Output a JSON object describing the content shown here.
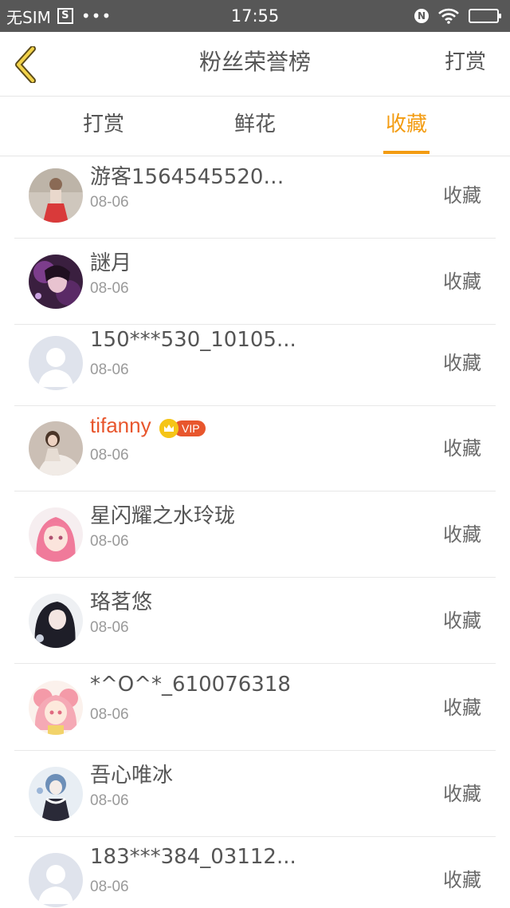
{
  "status_bar": {
    "carrier": "无SIM",
    "s_icon_label": "S",
    "dots": "•••",
    "time": "17:55",
    "n_icon_label": "N"
  },
  "nav": {
    "back_icon": "chevron-left-icon",
    "title": "粉丝荣誉榜",
    "action_label": "打赏"
  },
  "tabs": [
    {
      "label": "打赏",
      "active": false
    },
    {
      "label": "鲜花",
      "active": false
    },
    {
      "label": "收藏",
      "active": true
    }
  ],
  "accent_color": "#f39c12",
  "vip_color": "#e8562d",
  "list": {
    "items": [
      {
        "name": "游客1564545520…",
        "date": "08-06",
        "action": "收藏",
        "avatar": "girl-photo"
      },
      {
        "name": "謎月",
        "date": "08-06",
        "action": "收藏",
        "avatar": "anime-dark"
      },
      {
        "name": "150***530_10105...",
        "date": "08-06",
        "action": "收藏",
        "avatar": "default"
      },
      {
        "name": "tifanny",
        "date": "08-06",
        "action": "收藏",
        "avatar": "woman-photo",
        "vip": true,
        "vip_label": "VIP"
      },
      {
        "name": "星闪耀之水玲珑",
        "date": "08-06",
        "action": "收藏",
        "avatar": "anime-pink"
      },
      {
        "name": "珞茗悠",
        "date": "08-06",
        "action": "收藏",
        "avatar": "anime-black-hair"
      },
      {
        "name": "*^O^*_610076318",
        "date": "08-06",
        "action": "收藏",
        "avatar": "anime-pink-hair"
      },
      {
        "name": "吾心唯冰",
        "date": "08-06",
        "action": "收藏",
        "avatar": "anime-blue"
      },
      {
        "name": "183***384_03112...",
        "date": "08-06",
        "action": "收藏",
        "avatar": "default"
      }
    ]
  }
}
